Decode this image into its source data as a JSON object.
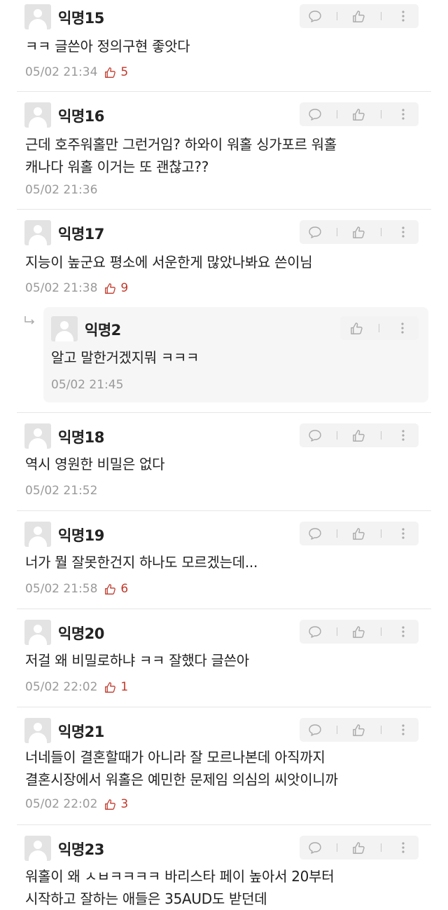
{
  "colors": {
    "accent_like": "#c0392b",
    "meta_gray": "#9a9a9a",
    "action_bg": "#f3f3f3"
  },
  "icons": {
    "comment": "speech-bubble-icon",
    "like": "thumbs-up-icon",
    "more": "vertical-dots-icon",
    "avatar": "default-avatar-icon",
    "reply": "reply-arrow-icon"
  },
  "comments": [
    {
      "name": "익명15",
      "lines": [
        "ㅋㅋ 글쓴아 정의구현 좋앗다"
      ],
      "time": "05/02 21:34",
      "likes": "5"
    },
    {
      "name": "익명16",
      "lines": [
        "근데 호주워홀만 그런거임? 하와이 워홀 싱가포르 워홀",
        "캐나다 워홀 이거는 또 괜찮고??"
      ],
      "time": "05/02 21:36",
      "likes": ""
    },
    {
      "name": "익명17",
      "lines": [
        "지능이 높군요 평소에 서운한게 많았나봐요 쓴이님"
      ],
      "time": "05/02 21:38",
      "likes": "9"
    },
    {
      "name": "익명18",
      "lines": [
        "역시 영원한 비밀은 없다"
      ],
      "time": "05/02 21:52",
      "likes": ""
    },
    {
      "name": "익명19",
      "lines": [
        "너가 뭘 잘못한건지 하나도 모르겠는데..."
      ],
      "time": "05/02 21:58",
      "likes": "6"
    },
    {
      "name": "익명20",
      "lines": [
        "저걸 왜 비밀로하냐 ㅋㅋ 잘했다 글쓴아"
      ],
      "time": "05/02 22:02",
      "likes": "1"
    },
    {
      "name": "익명21",
      "lines": [
        "너네들이 결혼할때가 아니라 잘 모르나본데 아직까지",
        "결혼시장에서 워홀은 예민한 문제임 의심의 씨앗이니까"
      ],
      "time": "05/02 22:02",
      "likes": "3"
    },
    {
      "name": "익명23",
      "lines": [
        "워홀이 왜 ㅅㅂㅋㅋㅋㅋ 바리스타 페이 높아서 20부터",
        "시작하고 잘하는 애들은 35AUD도 받던데"
      ],
      "time": "",
      "likes": ""
    }
  ],
  "reply": {
    "name": "익명2",
    "text": "알고 말한거겠지뭐 ㅋㅋㅋ",
    "time": "05/02 21:45"
  }
}
